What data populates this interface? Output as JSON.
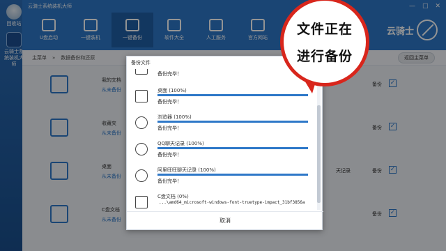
{
  "desktop": {
    "recycle_label": "回收站",
    "knight_label": "云骑士系统装机大师"
  },
  "app": {
    "title": "云骑士系统装机大师",
    "window_buttons": [
      "—",
      "□",
      "✕"
    ],
    "nav": [
      {
        "label": "U盘启动",
        "icon": "usb-icon"
      },
      {
        "label": "一键装机",
        "icon": "windows-icon"
      },
      {
        "label": "一键备份",
        "icon": "backup-icon"
      },
      {
        "label": "软件大全",
        "icon": "grid-icon"
      },
      {
        "label": "人工服务",
        "icon": "chat-icon"
      },
      {
        "label": "官方网站",
        "icon": "home-icon"
      }
    ],
    "brand": "云骑士",
    "breadcrumb": {
      "home": "主菜单",
      "separator": "»",
      "current": "数据备份和还原"
    },
    "back_button": "返回主菜单",
    "rows": [
      {
        "name": "我的文档",
        "sub": "从未备份",
        "state": "备份",
        "icon": "document-icon"
      },
      {
        "name": "收藏夹",
        "sub": "从未备份",
        "state": "备份",
        "icon": "folder-icon"
      },
      {
        "name": "桌面",
        "sub": "从未备份",
        "state": "备份",
        "extra": "天记录",
        "icon": "monitor-icon"
      },
      {
        "name": "C盘文档",
        "sub": "从未备份",
        "state": "备份",
        "icon": "disk-icon"
      }
    ],
    "checkbox_mark": "✓"
  },
  "dialog": {
    "title": "备份文件",
    "items": [
      {
        "name": "",
        "status": "备份完毕！",
        "progress": 1.0,
        "icon": "generic-icon"
      },
      {
        "name": "桌面 (100%)",
        "status": "备份完毕！",
        "progress": 1.0,
        "icon": "monitor-icon"
      },
      {
        "name": "浏览器 (100%)",
        "status": "备份完毕！",
        "progress": 1.0,
        "icon": "browser-icon"
      },
      {
        "name": "QQ聊天记录 (100%)",
        "status": "备份完毕！",
        "progress": 1.0,
        "icon": "qq-icon"
      },
      {
        "name": "阿里旺旺聊天记录 (100%)",
        "status": "备份完毕！",
        "progress": 1.0,
        "icon": "wangwang-icon"
      },
      {
        "name": "C盘文档 (0%)",
        "status": "",
        "progress": 0.0,
        "icon": "document-icon"
      }
    ],
    "current_path": "...\\amd64_microsoft-windows-font-truetype-impact_31bf3856a",
    "cancel_label": "取消"
  },
  "bubble": {
    "line1": "文件正在",
    "line2": "进行备份"
  },
  "colors": {
    "accent": "#2e78c8",
    "bubble_border": "#d8261c"
  }
}
